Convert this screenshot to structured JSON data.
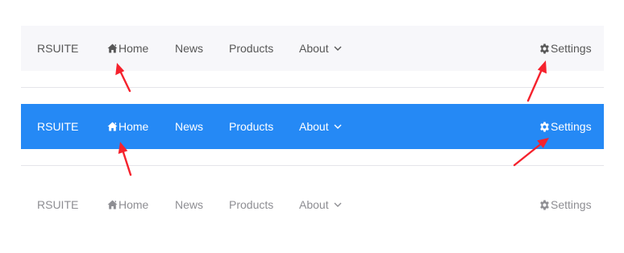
{
  "navbars": [
    {
      "variant": "default",
      "brand": "RSUITE",
      "items": [
        "Home",
        "News",
        "Products",
        "About"
      ],
      "settings": "Settings"
    },
    {
      "variant": "inverse",
      "brand": "RSUITE",
      "items": [
        "Home",
        "News",
        "Products",
        "About"
      ],
      "settings": "Settings"
    },
    {
      "variant": "subtle",
      "brand": "RSUITE",
      "items": [
        "Home",
        "News",
        "Products",
        "About"
      ],
      "settings": "Settings"
    }
  ],
  "icons": {
    "home": "home-icon",
    "settings": "gear-icon",
    "dropdown": "chevron-down-icon"
  },
  "colors": {
    "default_bg": "#f7f7fa",
    "default_text": "#575757",
    "inverse_bg": "#2589f5",
    "inverse_text": "#ffffff",
    "subtle_text": "#8e8e93",
    "annotation_arrow": "#f5222d"
  }
}
